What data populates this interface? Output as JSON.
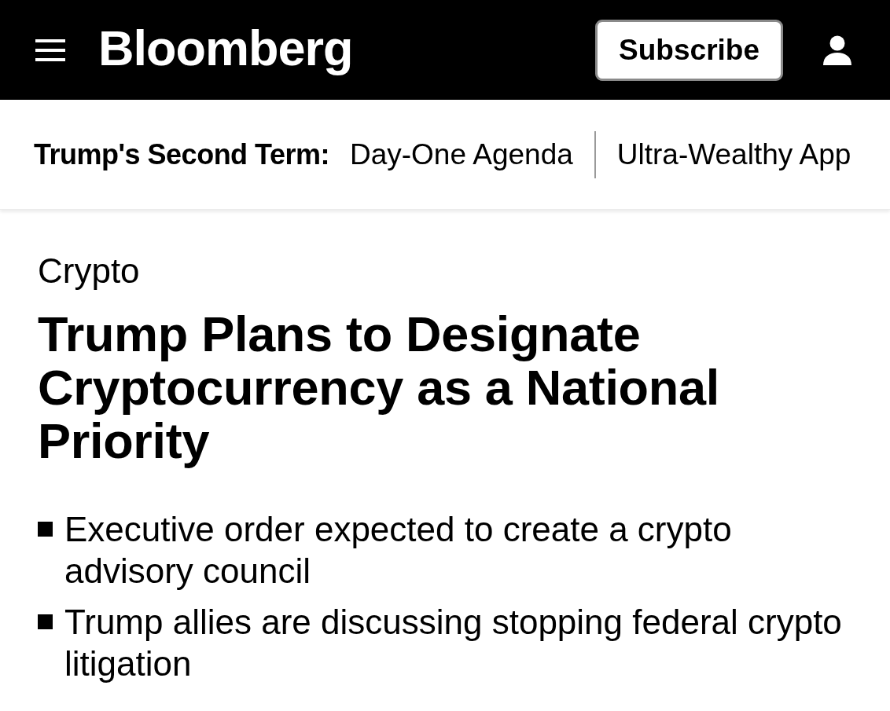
{
  "header": {
    "logo": "Bloomberg",
    "subscribe_button": "Subscribe"
  },
  "topic_bar": {
    "label": "Trump's Second Term:",
    "links": [
      "Day-One Agenda",
      "Ultra-Wealthy App"
    ]
  },
  "article": {
    "section": "Crypto",
    "headline": "Trump Plans to Designate Cryptocurrency as a National Priority",
    "bullets": [
      "Executive order expected to create a crypto advisory council",
      "Trump allies are discussing stopping federal crypto litigation"
    ]
  }
}
